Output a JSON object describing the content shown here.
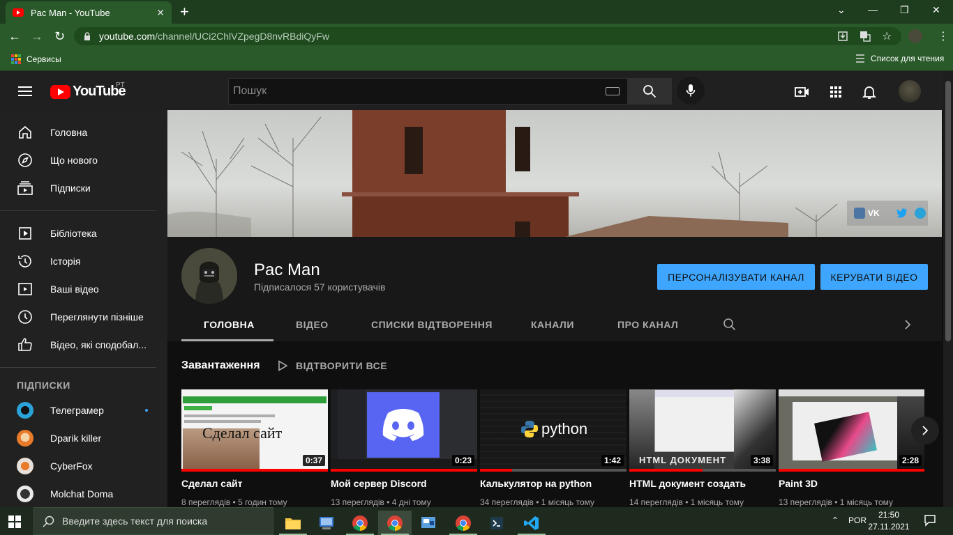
{
  "browser": {
    "tab_title": "Pac Man - YouTube",
    "url_host": "youtube.com",
    "url_path": "/channel/UCi2ChlVZpegD8nvRBdiQyFw",
    "bookmark_services": "Сервисы",
    "reading_list": "Список для чтения"
  },
  "masthead": {
    "logo_text": "YouTube",
    "region": "PT",
    "search_placeholder": "Пошук"
  },
  "sidebar": {
    "items": [
      {
        "label": "Головна",
        "icon": "home-icon"
      },
      {
        "label": "Що нового",
        "icon": "compass-icon"
      },
      {
        "label": "Підписки",
        "icon": "subscriptions-icon"
      },
      {
        "label": "Бібліотека",
        "icon": "library-icon"
      },
      {
        "label": "Історія",
        "icon": "history-icon"
      },
      {
        "label": "Ваші відео",
        "icon": "your-videos-icon"
      },
      {
        "label": "Переглянути пізніше",
        "icon": "watch-later-icon"
      },
      {
        "label": "Відео, які сподобал...",
        "icon": "thumb-up-icon"
      }
    ],
    "subscriptions_heading": "ПІДПИСКИ",
    "subscriptions": [
      {
        "name": "Телеграмер",
        "color": "#2aa3d8"
      },
      {
        "name": "Dparik killer",
        "color": "#e87a2a"
      },
      {
        "name": "CyberFox",
        "color": "#e8e0d8"
      },
      {
        "name": "Molchat Doma",
        "color": "#e8e8e8"
      }
    ]
  },
  "channel": {
    "social_vk": "VK",
    "name": "Pac Man",
    "subscribers": "Підписалося 57 користувачів",
    "customize_button": "ПЕРСОНАЛІЗУВАТИ КАНАЛ",
    "manage_button": "КЕРУВАТИ ВІДЕО",
    "tabs": [
      "ГОЛОВНА",
      "ВІДЕО",
      "СПИСКИ ВІДТВОРЕННЯ",
      "КАНАЛИ",
      "ПРО КАНАЛ"
    ]
  },
  "uploads": {
    "title": "Завантаження",
    "play_all": "ВІДТВОРИТИ ВСЕ",
    "videos": [
      {
        "title": "Сделал сайт",
        "views": "8 переглядів",
        "age": "5 годин тому",
        "duration": "0:37",
        "thumb_text": "Сделал сайт",
        "watched": 1.0
      },
      {
        "title": "Мой сервер Discord",
        "views": "13 переглядів",
        "age": "4 дні тому",
        "duration": "0:23",
        "watched": 1.0
      },
      {
        "title": "Калькулятор на python",
        "views": "34 переглядів",
        "age": "1 місяць тому",
        "duration": "1:42",
        "thumb_text": "python",
        "watched": 0.22
      },
      {
        "title": "HTML документ создать",
        "views": "14 переглядів",
        "age": "1 місяць тому",
        "duration": "3:38",
        "thumb_text": "HTML ДОКУМЕНТ",
        "watched": 0.5
      },
      {
        "title": "Paint 3D",
        "views": "13 переглядів",
        "age": "1 місяць тому",
        "duration": "2:28",
        "watched": 1.0
      }
    ]
  },
  "taskbar": {
    "search_placeholder": "Введите здесь текст для поиска",
    "language": "POR",
    "time": "21:50",
    "date": "27.11.2021"
  },
  "colors": {
    "accent_blue": "#3ea6ff",
    "youtube_red": "#ff0000",
    "browser_green": "#2a5a2a"
  }
}
